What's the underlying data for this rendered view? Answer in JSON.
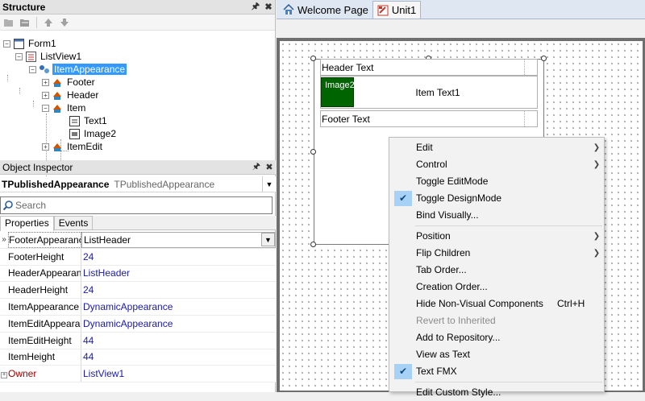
{
  "structure": {
    "title": "Structure",
    "pin_icon": "pin-icon",
    "close_icon": "close-icon",
    "tree": [
      {
        "label": "Form1",
        "icon": "form-icon"
      },
      {
        "label": "ListView1",
        "icon": "listview-icon"
      },
      {
        "label": "ItemAppearance",
        "icon": "appearance-icon",
        "selected": true
      },
      {
        "label": "Footer",
        "icon": "appearance-object-icon"
      },
      {
        "label": "Header",
        "icon": "appearance-object-icon"
      },
      {
        "label": "Item",
        "icon": "appearance-object-icon"
      },
      {
        "label": "Text1",
        "icon": "text-object-icon"
      },
      {
        "label": "Image2",
        "icon": "image-object-icon"
      },
      {
        "label": "ItemEdit",
        "icon": "appearance-object-icon"
      }
    ]
  },
  "object_inspector": {
    "title": "Object Inspector",
    "object_name": "TPublishedAppearance",
    "object_type": "TPublishedAppearance",
    "search_placeholder": "Search",
    "tabs": [
      "Properties",
      "Events"
    ],
    "properties": [
      {
        "name": "FooterAppearance",
        "value": "ListHeader"
      },
      {
        "name": "FooterHeight",
        "value": "24"
      },
      {
        "name": "HeaderAppearance",
        "value": "ListHeader"
      },
      {
        "name": "HeaderHeight",
        "value": "24"
      },
      {
        "name": "ItemAppearance",
        "value": "DynamicAppearance"
      },
      {
        "name": "ItemEditAppearance",
        "value": "DynamicAppearance"
      },
      {
        "name": "ItemEditHeight",
        "value": "44"
      },
      {
        "name": "ItemHeight",
        "value": "44"
      },
      {
        "name": "Owner",
        "value": "ListView1"
      }
    ]
  },
  "doc_tabs": [
    {
      "label": "Welcome Page",
      "icon": "home-icon"
    },
    {
      "label": "Unit1",
      "icon": "unit-icon"
    }
  ],
  "listview": {
    "header_text": "Header Text",
    "image_label": "Image2",
    "item_text": "Item Text1",
    "footer_text": "Footer Text"
  },
  "context_menu": [
    {
      "label": "Edit",
      "submenu": true
    },
    {
      "label": "Control",
      "submenu": true
    },
    {
      "label": "Toggle EditMode"
    },
    {
      "label": "Toggle DesignMode",
      "checked": true
    },
    {
      "label": "Bind Visually..."
    },
    {
      "label": "Position",
      "submenu": true
    },
    {
      "label": "Flip Children",
      "submenu": true
    },
    {
      "label": "Tab Order..."
    },
    {
      "label": "Creation Order..."
    },
    {
      "label": "Hide Non-Visual Components",
      "shortcut": "Ctrl+H"
    },
    {
      "label": "Revert to Inherited",
      "disabled": true
    },
    {
      "label": "Add to Repository..."
    },
    {
      "label": "View as Text"
    },
    {
      "label": "Text FMX",
      "checked": true
    },
    {
      "label": "Edit Custom Style..."
    }
  ],
  "colors": {
    "selection": "#3399ff",
    "image_bg": "#006400",
    "check_bg": "#a8d2f5",
    "value_text": "#1a1aa6"
  }
}
